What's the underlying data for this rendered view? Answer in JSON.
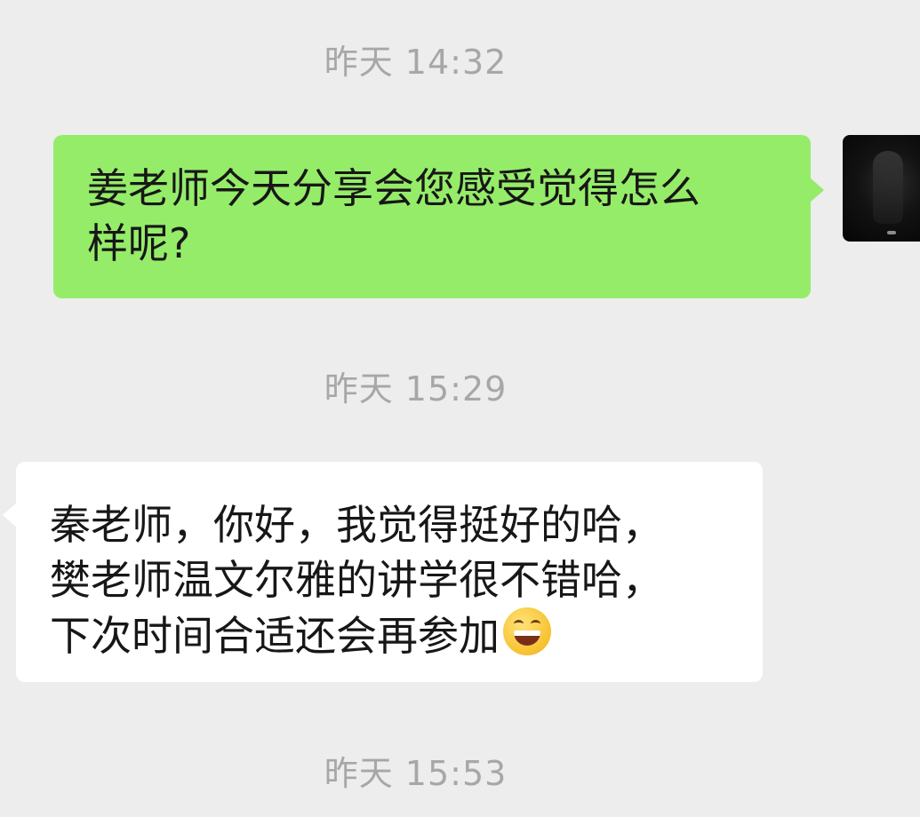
{
  "chat": {
    "timestamps": [
      "昨天 14:32",
      "昨天 15:29",
      "昨天 15:53"
    ],
    "messages": [
      {
        "direction": "sent",
        "lines": [
          "姜老师今天分享会您感受觉得怎么",
          "样呢?"
        ]
      },
      {
        "direction": "received",
        "lines": [
          "秦老师，你好，我觉得挺好的哈，",
          "樊老师温文尔雅的讲学很不错哈，",
          "下次时间合适还会再参加"
        ],
        "emoji": "grinning-face-emoji"
      }
    ]
  },
  "colors": {
    "background": "#ededed",
    "sent_bubble": "#95ec69",
    "received_bubble": "#ffffff",
    "timestamp_text": "#a7a7a7",
    "message_text": "#171717"
  },
  "icons": {
    "avatar": "user-avatar-photo",
    "emoji": "grinning-face-emoji"
  }
}
